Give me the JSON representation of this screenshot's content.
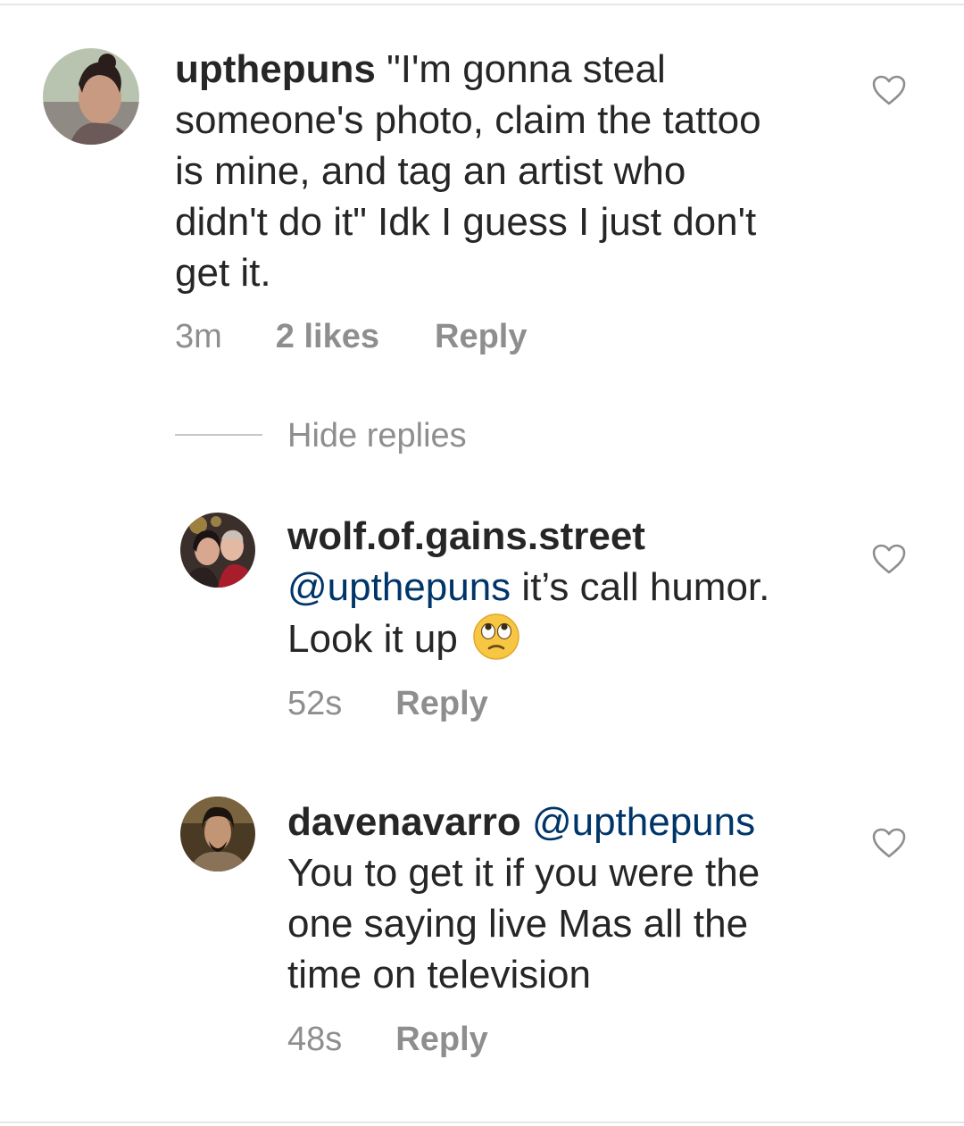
{
  "comments": [
    {
      "username": "upthepuns",
      "text_lines": [
        "\"I'm gonna steal",
        "someone's photo, claim the tattoo",
        "is mine, and tag an artist who",
        "didn't do it\" Idk I guess I just don't",
        "get it."
      ],
      "time": "3m",
      "likes": "2 likes",
      "reply_label": "Reply"
    }
  ],
  "hide_replies_label": "Hide replies",
  "replies": [
    {
      "username": "wolf.of.gains.street",
      "mention": "@upthepuns",
      "text_line1_rest": " it’s call humor.",
      "text_line2": "Look it up",
      "emoji": "face-with-rolling-eyes-emoji",
      "time": "52s",
      "reply_label": "Reply"
    },
    {
      "username": "davenavarro",
      "mention": "@upthepuns",
      "text_lines": [
        "You to get it if you were the",
        "one saying live Mas all the",
        "time on television"
      ],
      "time": "48s",
      "reply_label": "Reply"
    }
  ],
  "icons": {
    "like": "heart-outline-icon"
  },
  "colors": {
    "text": "#262626",
    "secondary": "#8e8e8e",
    "mention": "#003569"
  }
}
